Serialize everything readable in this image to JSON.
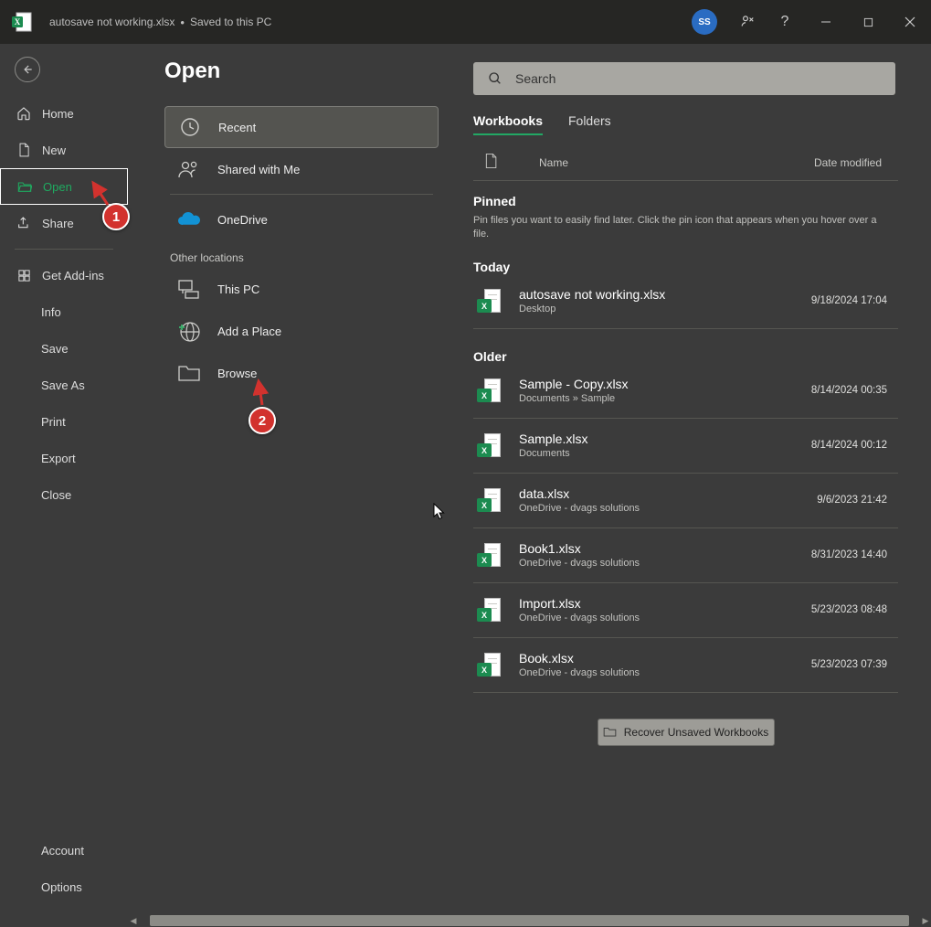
{
  "titlebar": {
    "filename": "autosave not working.xlsx",
    "status": "Saved to this PC",
    "avatar_initials": "SS"
  },
  "nav": {
    "home": "Home",
    "new": "New",
    "open": "Open",
    "share": "Share",
    "get_addins": "Get Add-ins",
    "info": "Info",
    "save": "Save",
    "save_as": "Save As",
    "print": "Print",
    "export": "Export",
    "close": "Close",
    "account": "Account",
    "options": "Options"
  },
  "page": {
    "title": "Open"
  },
  "locations": {
    "recent": "Recent",
    "shared": "Shared with Me",
    "onedrive": "OneDrive",
    "other_head": "Other locations",
    "thispc": "This PC",
    "addplace": "Add a Place",
    "browse": "Browse"
  },
  "search": {
    "placeholder": "Search"
  },
  "tabs": {
    "workbooks": "Workbooks",
    "folders": "Folders"
  },
  "cols": {
    "name": "Name",
    "date": "Date modified"
  },
  "pinned": {
    "title": "Pinned",
    "help": "Pin files you want to easily find later. Click the pin icon that appears when you hover over a file."
  },
  "today": {
    "title": "Today"
  },
  "older": {
    "title": "Older"
  },
  "files_today": [
    {
      "name": "autosave not working.xlsx",
      "location": "Desktop",
      "date": "9/18/2024 17:04"
    }
  ],
  "files_older": [
    {
      "name": "Sample - Copy.xlsx",
      "location": "Documents » Sample",
      "date": "8/14/2024 00:35"
    },
    {
      "name": "Sample.xlsx",
      "location": "Documents",
      "date": "8/14/2024 00:12"
    },
    {
      "name": "data.xlsx",
      "location": "OneDrive - dvags solutions",
      "date": "9/6/2023 21:42"
    },
    {
      "name": "Book1.xlsx",
      "location": "OneDrive - dvags solutions",
      "date": "8/31/2023 14:40"
    },
    {
      "name": "Import.xlsx",
      "location": "OneDrive - dvags solutions",
      "date": "5/23/2023 08:48"
    },
    {
      "name": "Book.xlsx",
      "location": "OneDrive - dvags solutions",
      "date": "5/23/2023 07:39"
    }
  ],
  "recover": {
    "label": "Recover Unsaved Workbooks"
  },
  "annotations": {
    "b1": "1",
    "b2": "2"
  }
}
